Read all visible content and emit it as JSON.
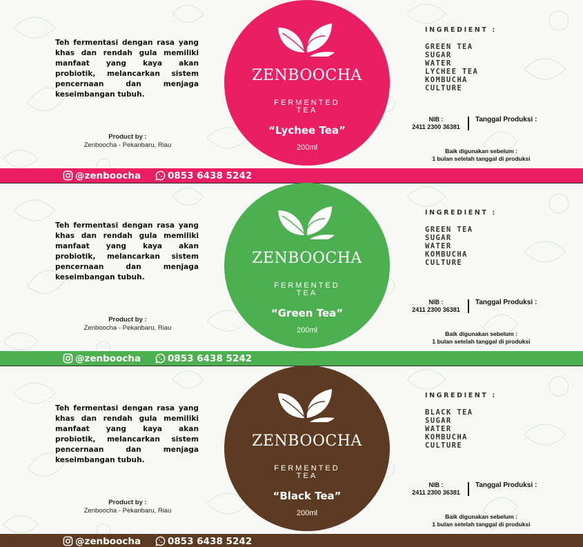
{
  "shared": {
    "description": "Teh fermentasi dengan rasa yang khas dan rendah gula memiliki manfaat yang kaya akan probiotik, melancarkan sistem pencernaan dan menjaga keseimbangan tubuh.",
    "product_by_label": "Product by :",
    "producer": "Zenboocha - Pekanbaru, Riau",
    "brand": "ZENBOOCHA",
    "subtitle_line1": "FERMENTED",
    "subtitle_line2": "TEA",
    "volume": "200ml",
    "ingredient_title": "INGREDIENT :",
    "nib_label": "NIB :",
    "nib_value": "2411 2300 36381",
    "production_label": "Tanggal Produksi :",
    "best_before_line1": "Baik digunakan sebelum :",
    "best_before_line2": "1 bulan setelah tanggal di produksi",
    "instagram_icon": "instagram-icon",
    "instagram": "@zenboocha",
    "whatsapp_icon": "whatsapp-icon",
    "phone": "0853 6438 5242",
    "leaf_icon": "tea-leaf-icon"
  },
  "labels": [
    {
      "flavor": "“Lychee Tea”",
      "color": "#e91e63",
      "ingredients": [
        "GREEN TEA",
        "SUGAR",
        "WATER",
        "LYCHEE TEA",
        "KOMBUCHA",
        "CULTURE"
      ]
    },
    {
      "flavor": "“Green Tea”",
      "color": "#4caf50",
      "ingredients": [
        "GREEN TEA",
        "SUGAR",
        "WATER",
        "KOMBUCHA",
        "CULTURE"
      ]
    },
    {
      "flavor": "“Black Tea”",
      "color": "#5d3a22",
      "ingredients": [
        "BLACK TEA",
        "SUGAR",
        "WATER",
        "KOMBUCHA",
        "CULTURE"
      ]
    }
  ]
}
